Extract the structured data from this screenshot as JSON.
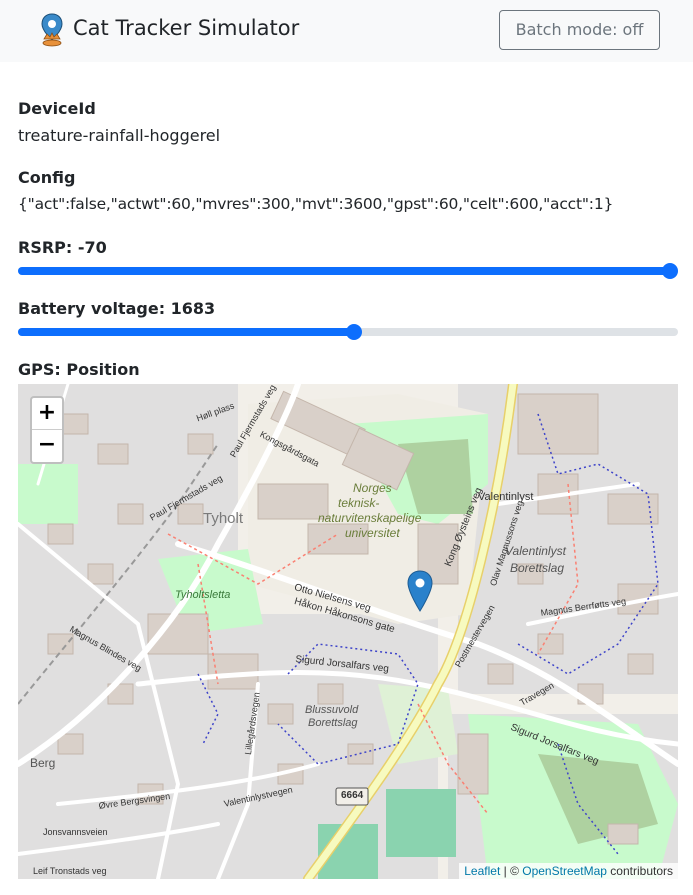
{
  "header": {
    "title": "Cat Tracker Simulator",
    "batch_button": "Batch mode: off"
  },
  "device": {
    "label": "DeviceId",
    "value": "treature-rainfall-hoggerel"
  },
  "config": {
    "label": "Config",
    "value": "{\"act\":false,\"actwt\":60,\"mvres\":300,\"mvt\":3600,\"gpst\":60,\"celt\":600,\"acct\":1}"
  },
  "rsrp": {
    "label": "RSRP: -70",
    "level_fraction": 1.0
  },
  "battery": {
    "label": "Battery voltage: 1683",
    "level_fraction": 0.51
  },
  "gps": {
    "label": "GPS: Position"
  },
  "map": {
    "zoom_in": "+",
    "zoom_out": "−",
    "attribution_link1": "Leaflet",
    "attribution_sep": " | © ",
    "attribution_link2": "OpenStreetMap",
    "attribution_tail": " contributors",
    "labels": {
      "tyholt": "Tyholt",
      "ntnu1": "Norges",
      "ntnu2": "teknisk-",
      "ntnu3": "naturvitenskapelige",
      "ntnu4": "universitet",
      "valentinlyst": "Valentinlyst",
      "borettslag1": "Valentinlyst",
      "borettslag2": "Borettslag",
      "tyholtsletta": "Tyholtsletta",
      "blussuvold1": "Blussuvold",
      "blussuvold2": "Borettslag",
      "berg": "Berg",
      "kong": "Kong Øysteins veg",
      "otto": "Otto Nielsens veg",
      "hakon": "Håkon Håkonsons gate",
      "sigurd": "Sigurd Jorsalfars veg",
      "sigurd2": "Sigurd Jorsalfars veg",
      "magnus": "Magnus Berrføtts veg",
      "magnus2": "Magnus Blindes veg",
      "paul": "Paul Fjermstads veg",
      "paul2": "Paul Fjermstads veg",
      "kong_sverre": "Kongsgårdsgata",
      "hollplass": "Høll plass",
      "lillegard": "Lillegårdsvegen",
      "valentinlystvegen": "Valentinlystvegen",
      "ovre": "Øvre Bergsvingen",
      "jonsvann": "Jonsvannsveien",
      "leif": "Leif Tronstads veg",
      "road6664": "6664",
      "travegen": "Travegen",
      "postmeister": "Postmestervegen",
      "olav": "Olav Magnussons veg"
    }
  },
  "colors": {
    "primary": "#0d6efd",
    "navbar_bg": "#f8f9fa",
    "track": "#dee2e6",
    "button_outline": "#6c757d"
  }
}
